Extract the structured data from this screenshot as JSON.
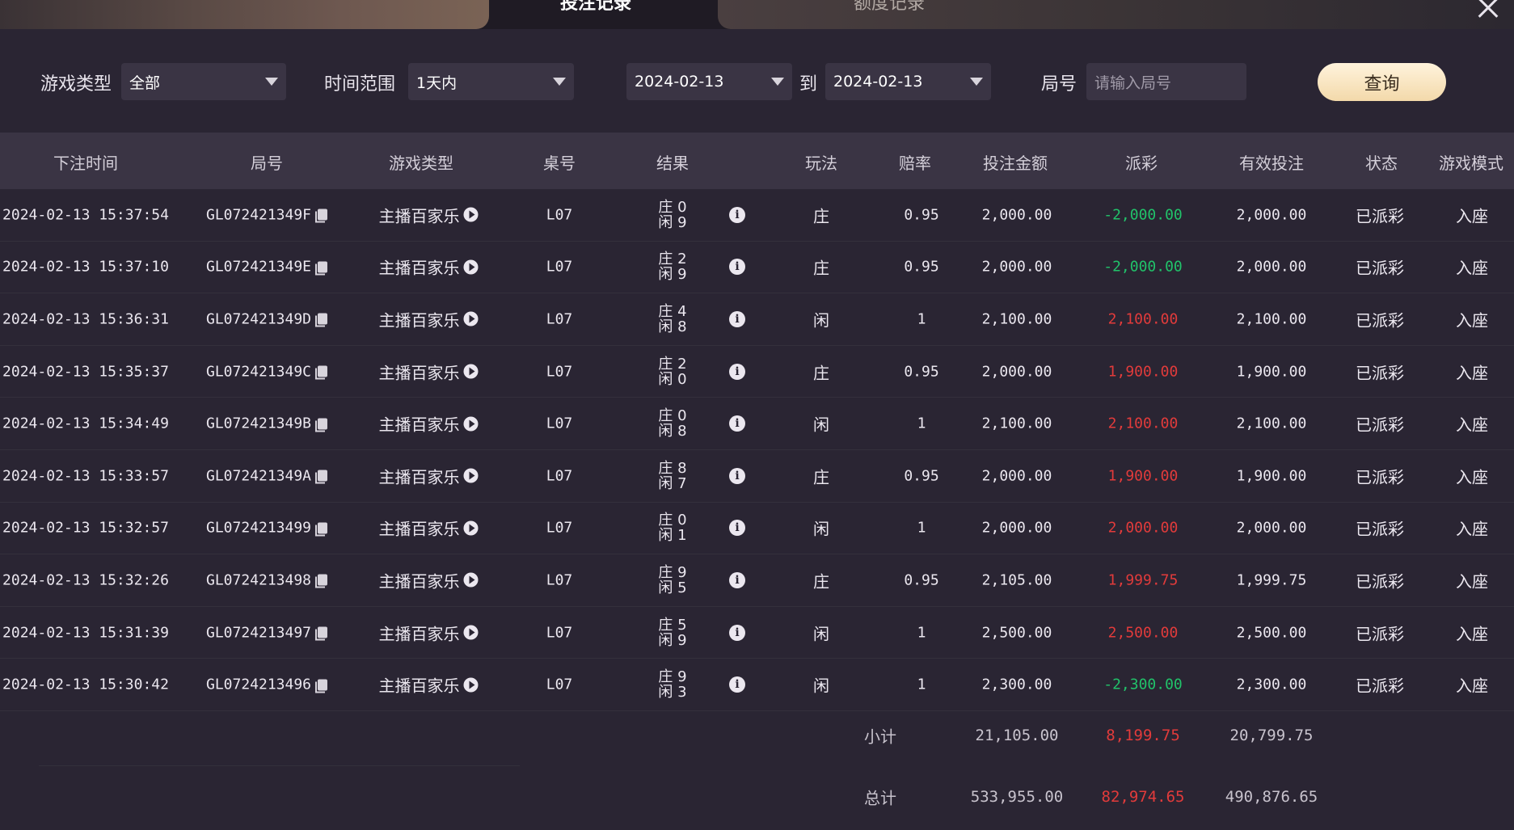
{
  "tabs": {
    "active": "投注记录",
    "inactive": "额度记录"
  },
  "filters": {
    "game_type_label": "游戏类型",
    "game_type_value": "全部",
    "time_range_label": "时间范围",
    "time_range_value": "1天内",
    "date_from": "2024-02-13",
    "to_label": "到",
    "date_to": "2024-02-13",
    "round_label": "局号",
    "round_placeholder": "请输入局号",
    "query_button": "查询"
  },
  "columns": [
    "下注时间",
    "局号",
    "游戏类型",
    "桌号",
    "结果",
    "玩法",
    "赔率",
    "投注金额",
    "派彩",
    "有效投注",
    "状态",
    "游戏模式"
  ],
  "rows": [
    {
      "time": "2024-02-13 15:37:54",
      "round": "GL072421349F",
      "game": "主播百家乐",
      "table": "L07",
      "banker": "庄 0",
      "player": "闲 9",
      "play": "庄",
      "odds": "0.95",
      "bet": "2,000.00",
      "payout": "-2,000.00",
      "payout_sign": "neg",
      "valid": "2,000.00",
      "status": "已派彩",
      "mode": "入座"
    },
    {
      "time": "2024-02-13 15:37:10",
      "round": "GL072421349E",
      "game": "主播百家乐",
      "table": "L07",
      "banker": "庄 2",
      "player": "闲 9",
      "play": "庄",
      "odds": "0.95",
      "bet": "2,000.00",
      "payout": "-2,000.00",
      "payout_sign": "neg",
      "valid": "2,000.00",
      "status": "已派彩",
      "mode": "入座"
    },
    {
      "time": "2024-02-13 15:36:31",
      "round": "GL072421349D",
      "game": "主播百家乐",
      "table": "L07",
      "banker": "庄 4",
      "player": "闲 8",
      "play": "闲",
      "odds": "1",
      "bet": "2,100.00",
      "payout": "2,100.00",
      "payout_sign": "pos",
      "valid": "2,100.00",
      "status": "已派彩",
      "mode": "入座"
    },
    {
      "time": "2024-02-13 15:35:37",
      "round": "GL072421349C",
      "game": "主播百家乐",
      "table": "L07",
      "banker": "庄 2",
      "player": "闲 0",
      "play": "庄",
      "odds": "0.95",
      "bet": "2,000.00",
      "payout": "1,900.00",
      "payout_sign": "pos",
      "valid": "1,900.00",
      "status": "已派彩",
      "mode": "入座"
    },
    {
      "time": "2024-02-13 15:34:49",
      "round": "GL072421349B",
      "game": "主播百家乐",
      "table": "L07",
      "banker": "庄 0",
      "player": "闲 8",
      "play": "闲",
      "odds": "1",
      "bet": "2,100.00",
      "payout": "2,100.00",
      "payout_sign": "pos",
      "valid": "2,100.00",
      "status": "已派彩",
      "mode": "入座"
    },
    {
      "time": "2024-02-13 15:33:57",
      "round": "GL072421349A",
      "game": "主播百家乐",
      "table": "L07",
      "banker": "庄 8",
      "player": "闲 7",
      "play": "庄",
      "odds": "0.95",
      "bet": "2,000.00",
      "payout": "1,900.00",
      "payout_sign": "pos",
      "valid": "1,900.00",
      "status": "已派彩",
      "mode": "入座"
    },
    {
      "time": "2024-02-13 15:32:57",
      "round": "GL0724213499",
      "game": "主播百家乐",
      "table": "L07",
      "banker": "庄 0",
      "player": "闲 1",
      "play": "闲",
      "odds": "1",
      "bet": "2,000.00",
      "payout": "2,000.00",
      "payout_sign": "pos",
      "valid": "2,000.00",
      "status": "已派彩",
      "mode": "入座"
    },
    {
      "time": "2024-02-13 15:32:26",
      "round": "GL0724213498",
      "game": "主播百家乐",
      "table": "L07",
      "banker": "庄 9",
      "player": "闲 5",
      "play": "庄",
      "odds": "0.95",
      "bet": "2,105.00",
      "payout": "1,999.75",
      "payout_sign": "pos",
      "valid": "1,999.75",
      "status": "已派彩",
      "mode": "入座"
    },
    {
      "time": "2024-02-13 15:31:39",
      "round": "GL0724213497",
      "game": "主播百家乐",
      "table": "L07",
      "banker": "庄 5",
      "player": "闲 9",
      "play": "闲",
      "odds": "1",
      "bet": "2,500.00",
      "payout": "2,500.00",
      "payout_sign": "pos",
      "valid": "2,500.00",
      "status": "已派彩",
      "mode": "入座"
    },
    {
      "time": "2024-02-13 15:30:42",
      "round": "GL0724213496",
      "game": "主播百家乐",
      "table": "L07",
      "banker": "庄 9",
      "player": "闲 3",
      "play": "闲",
      "odds": "1",
      "bet": "2,300.00",
      "payout": "-2,300.00",
      "payout_sign": "neg",
      "valid": "2,300.00",
      "status": "已派彩",
      "mode": "入座"
    }
  ],
  "subtotal": {
    "label": "小计",
    "bet": "21,105.00",
    "payout": "8,199.75",
    "valid": "20,799.75"
  },
  "total": {
    "label": "总计",
    "bet": "533,955.00",
    "payout": "82,974.65",
    "valid": "490,876.65"
  },
  "colors": {
    "background": "#2a2533",
    "header_bg": "#3a3444",
    "positive": "#e23b3b",
    "negative": "#21c36a",
    "button_gold": "#f3d9aa"
  },
  "icons": {
    "close": "close-icon",
    "copy": "copy-icon",
    "play": "play-circle-icon",
    "info": "info-circle-icon",
    "dropdown": "caret-down-icon"
  }
}
